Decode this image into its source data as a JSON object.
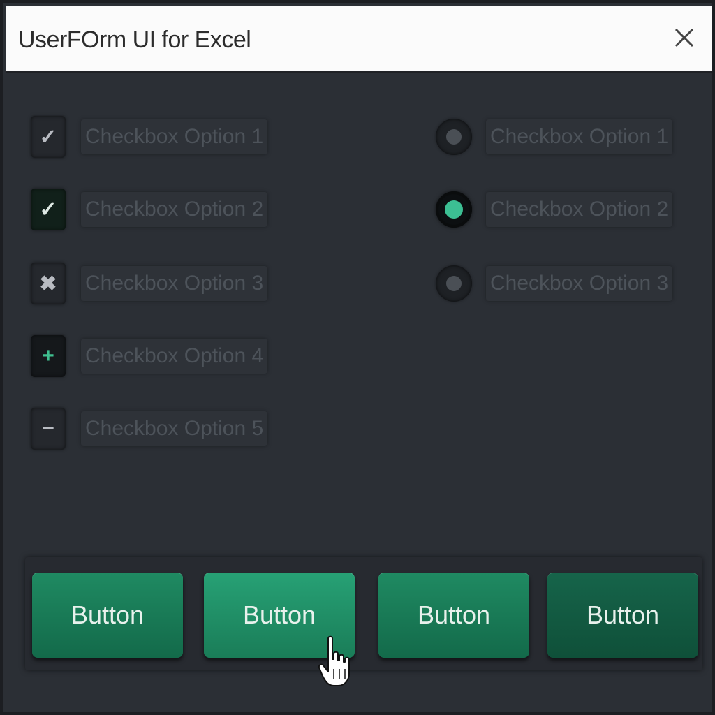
{
  "window": {
    "title": "UserFOrm UI for Excel",
    "close_label": "X"
  },
  "checkboxes": [
    {
      "label": "Checkbox Option 1",
      "glyph": "✓",
      "state": "checked"
    },
    {
      "label": "Checkbox Option 2",
      "glyph": "✓",
      "state": "checked-focused"
    },
    {
      "label": "Checkbox Option 3",
      "glyph": "✖",
      "state": "crossed"
    },
    {
      "label": "Checkbox Option 4",
      "glyph": "+",
      "state": "plus"
    },
    {
      "label": "Checkbox Option 5",
      "glyph": "−",
      "state": "minus"
    }
  ],
  "radios": [
    {
      "label": "Checkbox Option 1",
      "selected": false
    },
    {
      "label": "Checkbox Option 2",
      "selected": true
    },
    {
      "label": "Checkbox Option 3",
      "selected": false
    }
  ],
  "buttons": [
    {
      "label": "Button"
    },
    {
      "label": "Button"
    },
    {
      "label": "Button"
    },
    {
      "label": "Button"
    }
  ],
  "colors": {
    "accent_green": "#1f8a62",
    "radio_selected": "#3cbf93",
    "background": "#2b2f35",
    "titlebar": "#fbfbfb"
  },
  "icons": {
    "close": "close-icon",
    "check": "checkmark-icon",
    "cross": "cross-icon",
    "plus": "plus-icon",
    "minus": "minus-icon",
    "cursor": "hand-pointer-icon"
  }
}
